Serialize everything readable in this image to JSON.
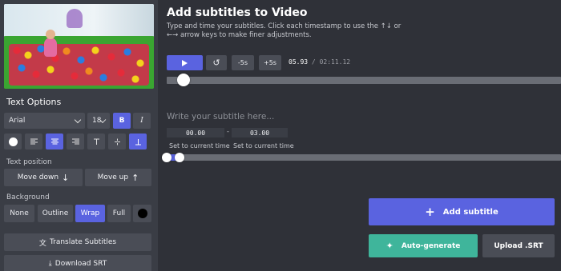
{
  "left": {
    "text_options_title": "Text Options",
    "font": {
      "selected": "Arial"
    },
    "size": {
      "selected": "18"
    },
    "bold_label": "B",
    "italic_label": "I",
    "text_position_label": "Text position",
    "move_down_label": "Move down",
    "move_up_label": "Move up",
    "background_label": "Background",
    "bg_options": [
      {
        "label": "None",
        "active": false
      },
      {
        "label": "Outline",
        "active": false
      },
      {
        "label": "Wrap",
        "active": true
      },
      {
        "label": "Full",
        "active": false
      }
    ],
    "translate_label": "Translate Subtitles",
    "download_label": "Download SRT"
  },
  "right": {
    "title": "Add subtitles to Video",
    "description": "Type and time your subtitles. Click each timestamp to use the ↑↓ or ←→ arrow keys to make finer adjustments.",
    "player": {
      "back_label": "-5s",
      "fwd_label": "+5s",
      "current_time": "05.93",
      "separator": "/",
      "total_time": "02:11.12",
      "progress_fraction": 0.043
    },
    "subtitle": {
      "placeholder": "Write your subtitle here...",
      "start_time": "00.00",
      "dash": "-",
      "end_time": "03.00",
      "set_current_start": "Set to current time",
      "set_current_end": "Set to current time"
    },
    "add_subtitle_label": "Add subtitle",
    "auto_generate_label": "Auto-generate",
    "upload_label": "Upload .SRT"
  },
  "colors": {
    "accent": "#5a63e0",
    "teal": "#3fb59b",
    "panel": "#3a3d45",
    "background": "#2f3138"
  }
}
